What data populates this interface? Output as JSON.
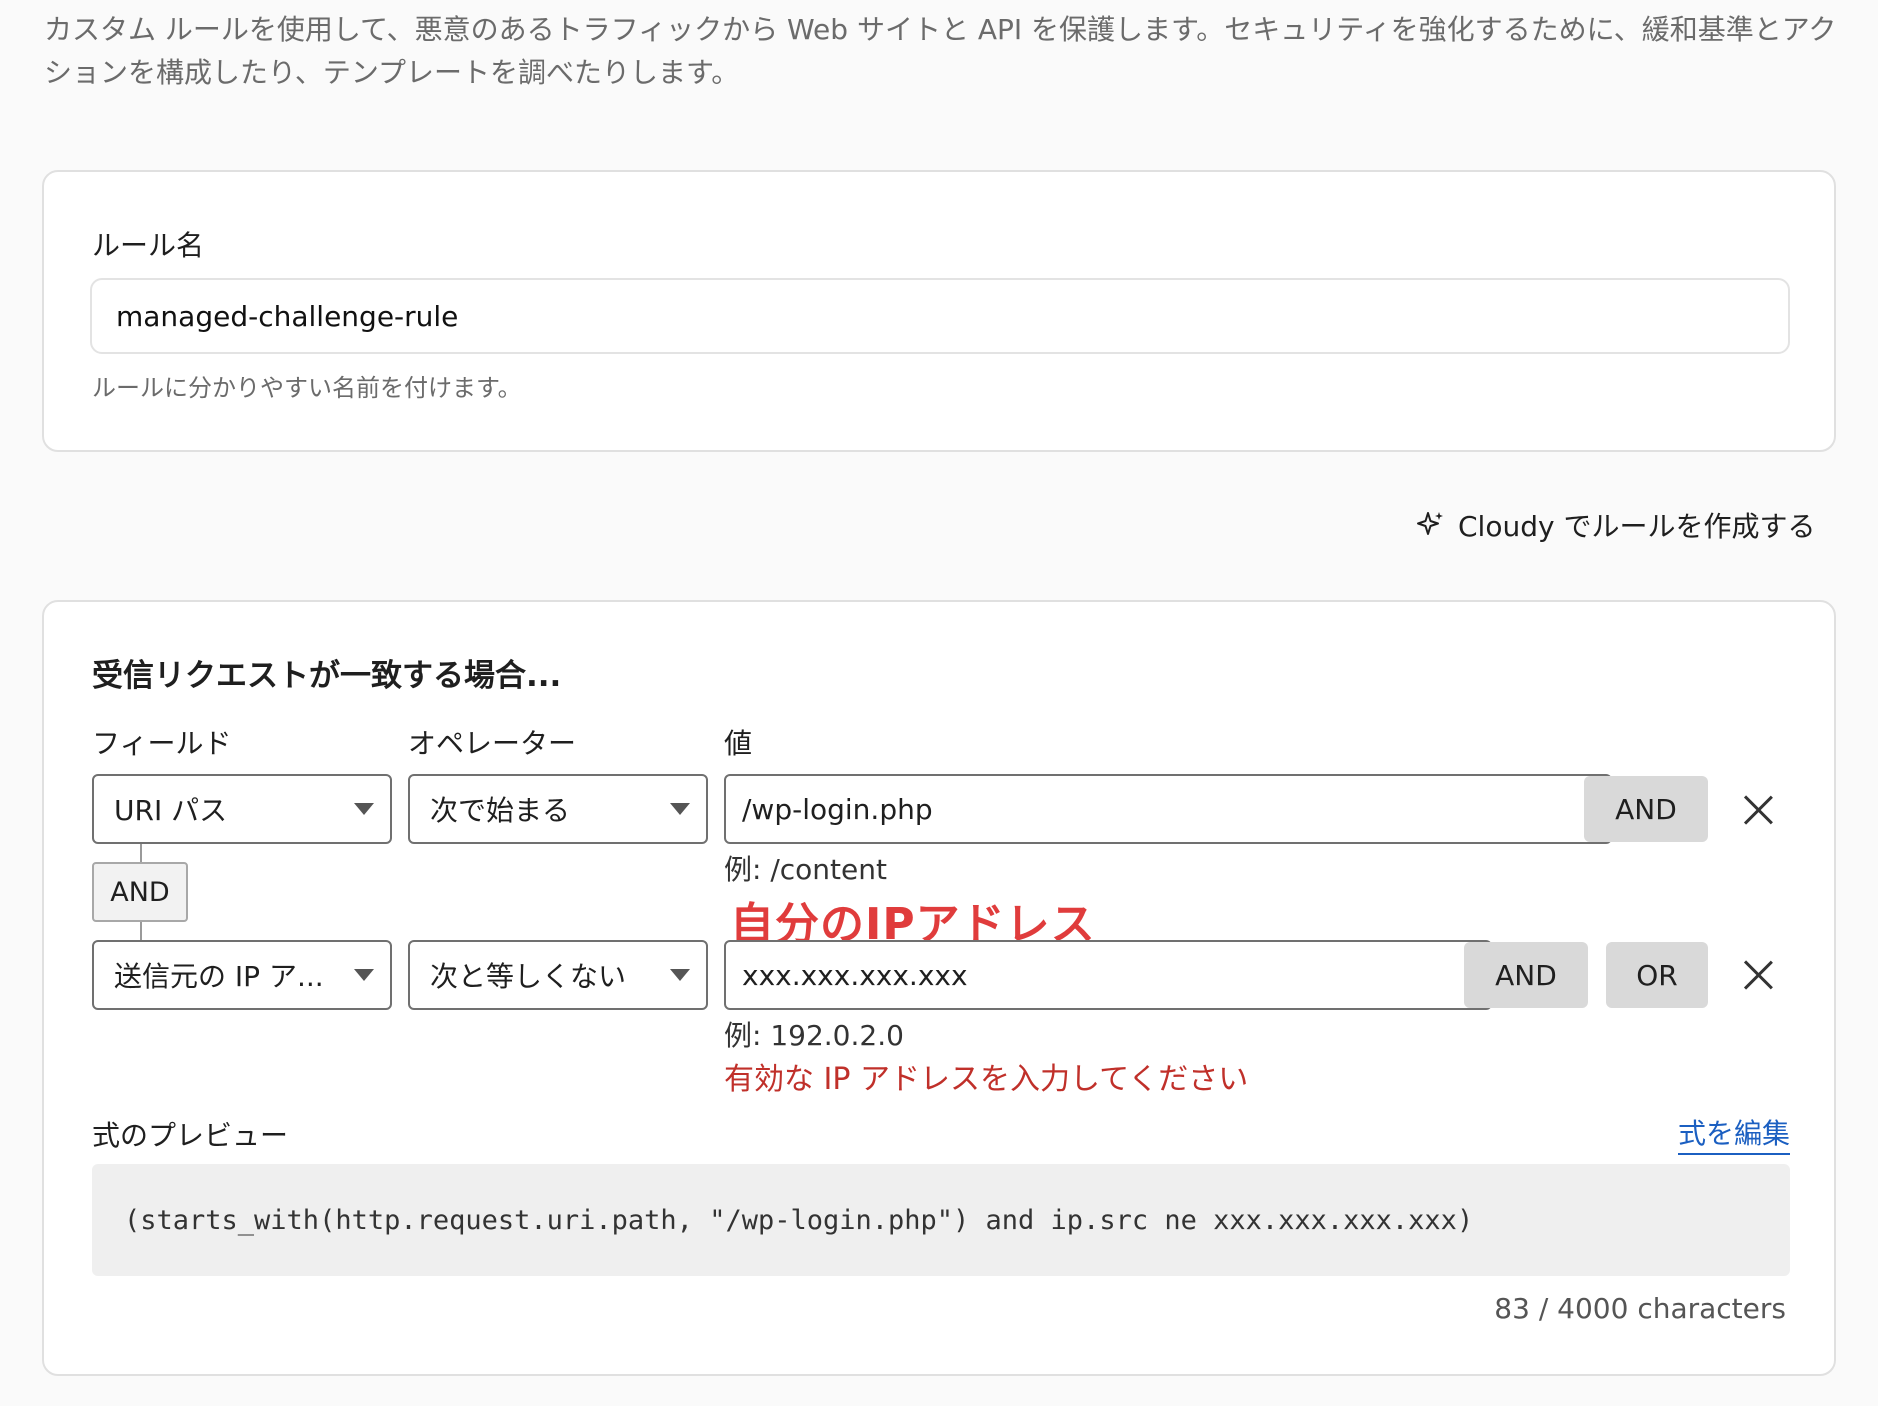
{
  "intro_text": "カスタム ルールを使用して、悪意のあるトラフィックから Web サイトと API を保護します。セキュリティを強化するために、緩和基準とアクションを構成したり、テンプレートを調べたりします。",
  "rule_name": {
    "label": "ルール名",
    "value": "managed-challenge-rule",
    "help": "ルールに分かりやすい名前を付けます。"
  },
  "cloudy": {
    "icon": "sparkle-icon",
    "label": "Cloudy でルールを作成する"
  },
  "match": {
    "heading": "受信リクエストが一致する場合...",
    "col_field": "フィールド",
    "col_operator": "オペレーター",
    "col_value": "値",
    "conditions": [
      {
        "field": "URI パス",
        "operator": "次で始まる",
        "value": "/wp-login.php",
        "example": "例: /content",
        "and_label": "AND"
      },
      {
        "field": "送信元の IP ア...",
        "operator": "次と等しくない",
        "value": "xxx.xxx.xxx.xxx",
        "example": "例: 192.0.2.0",
        "error": "有効な IP アドレスを入力してください",
        "and_label": "AND",
        "or_label": "OR"
      }
    ],
    "connector_label": "AND",
    "annotation": "自分のIPアドレス",
    "preview_label": "式のプレビュー",
    "edit_link": "式を編集",
    "expression": "(starts_with(http.request.uri.path, \"/wp-login.php\") and ip.src ne xxx.xxx.xxx.xxx)",
    "char_count": "83 / 4000 characters"
  },
  "colors": {
    "annotation": "#e03c3c",
    "error": "#c0302a",
    "link": "#1b5fc1"
  }
}
